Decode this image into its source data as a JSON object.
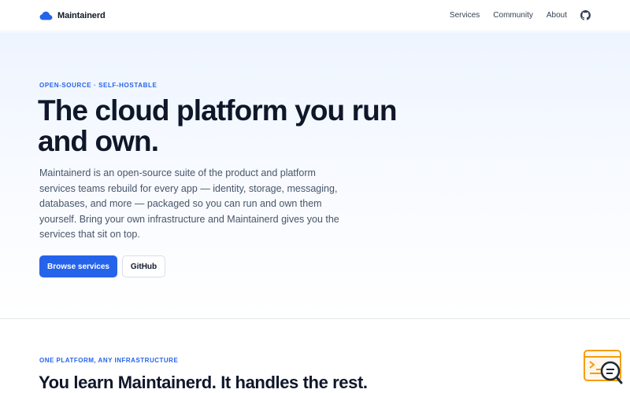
{
  "header": {
    "brand_name": "Maintainerd",
    "brand_icon": "cloud-icon",
    "nav": [
      "Services",
      "Community",
      "About"
    ],
    "github_icon": "github-icon"
  },
  "hero": {
    "eyebrow": "OPEN-SOURCE · SELF-HOSTABLE",
    "title": "The cloud platform you run and own.",
    "description": "Maintainerd is an open-source suite of the product and platform services teams rebuild for every app — identity, storage, messaging, databases, and more — packaged so you can run and own them yourself. Bring your own infrastructure and Maintainerd gives you the services that sit on top.",
    "primary_button": "Browse services",
    "secondary_button": "GitHub"
  },
  "section2": {
    "eyebrow": "ONE PLATFORM, ANY INFRASTRUCTURE",
    "title": "You learn Maintainerd. It handles the rest."
  },
  "widget": {
    "icon": "terminal-search-icon"
  },
  "colors": {
    "accent": "#2563eb",
    "heading": "#0f172a",
    "body_text": "#475569"
  }
}
